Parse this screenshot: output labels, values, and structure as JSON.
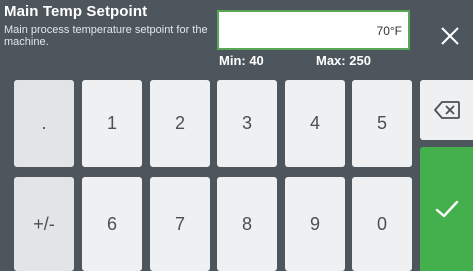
{
  "dialog": {
    "title": "Main Temp Setpoint",
    "description": "Main process temperature setpoint for the machine.",
    "value": "70°F",
    "min_label": "Min: 40",
    "max_label": "Max: 250"
  },
  "keys": {
    "decimal": ".",
    "sign": "+/-",
    "k1": "1",
    "k2": "2",
    "k3": "3",
    "k4": "4",
    "k5": "5",
    "k6": "6",
    "k7": "7",
    "k8": "8",
    "k9": "9",
    "k0": "0"
  },
  "icons": {
    "close": "close-icon",
    "backspace": "backspace-icon",
    "enter": "checkmark-icon"
  },
  "colors": {
    "header": "#4e565d",
    "key": "#eef0f2",
    "accent_green": "#43b04d",
    "value_border": "#5aa757"
  }
}
